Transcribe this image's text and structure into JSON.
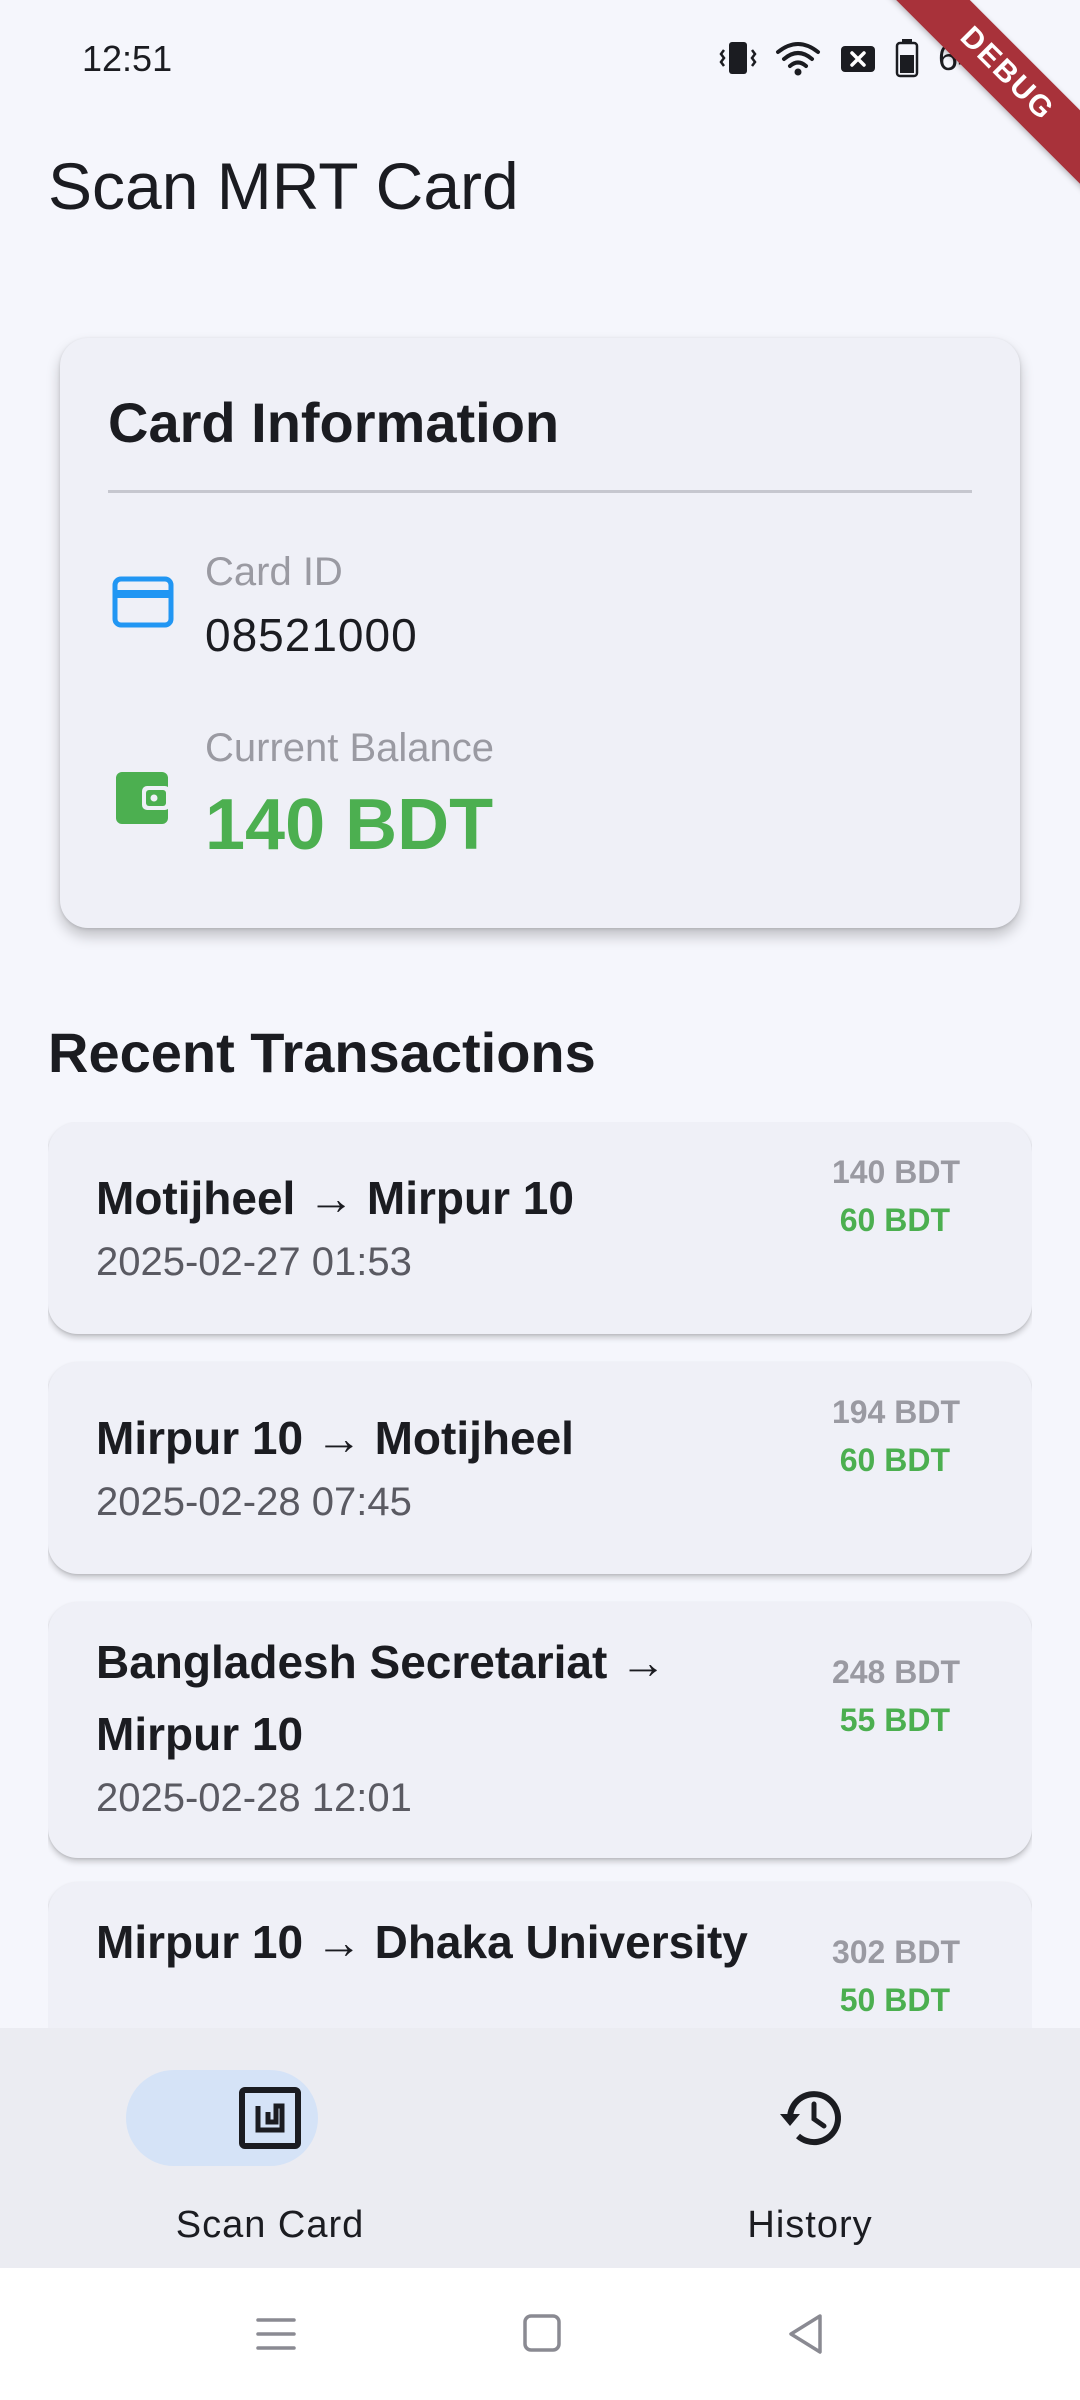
{
  "status_bar": {
    "time": "12:51",
    "battery_percent": "64%"
  },
  "debug_ribbon": "DEBUG",
  "app_bar": {
    "title": "Scan MRT Card"
  },
  "card_info": {
    "title": "Card Information",
    "card_id_label": "Card ID",
    "card_id_value": "08521000",
    "balance_label": "Current Balance",
    "balance_value": "140 BDT"
  },
  "transactions": {
    "title": "Recent Transactions",
    "items": [
      {
        "route": "Motijheel → Mirpur 10",
        "date": "2025-02-27 01:53",
        "balance": "140 BDT",
        "fare": "60 BDT"
      },
      {
        "route": "Mirpur 10 → Motijheel",
        "date": "2025-02-28 07:45",
        "balance": "194 BDT",
        "fare": "60 BDT"
      },
      {
        "route": "Bangladesh Secretariat → Mirpur 10",
        "date": "2025-02-28 12:01",
        "balance": "248 BDT",
        "fare": "55 BDT"
      },
      {
        "route": "Mirpur 10 → Dhaka University",
        "date": "",
        "balance": "302 BDT",
        "fare": "50 BDT"
      }
    ]
  },
  "bottom_nav": {
    "items": [
      {
        "label": "Scan Card",
        "icon": "nfc-icon",
        "selected": true
      },
      {
        "label": "History",
        "icon": "history-icon",
        "selected": false
      }
    ]
  },
  "colors": {
    "balance_green": "#4caf50",
    "card_icon_blue": "#2196f3",
    "debug_ribbon": "#a8323a",
    "nav_indicator": "#d5e3f7",
    "background": "#f5f6fc"
  }
}
